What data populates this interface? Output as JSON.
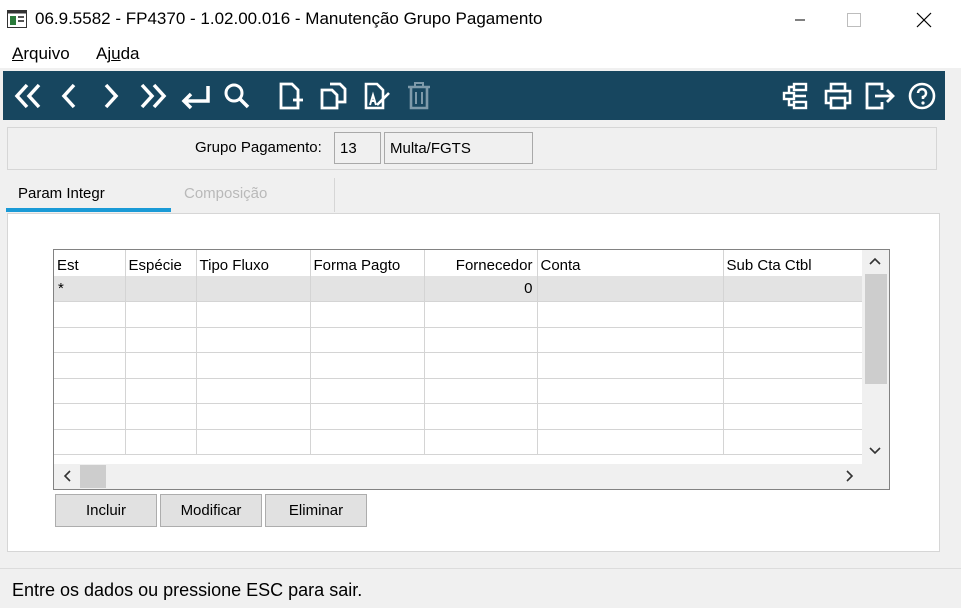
{
  "window": {
    "title": "06.9.5582 - FP4370 - 1.02.00.016 - Manutenção Grupo Pagamento"
  },
  "menu": {
    "items": [
      {
        "accel": "A",
        "rest": "rquivo"
      },
      {
        "pre": "Aj",
        "accel": "u",
        "rest": "da"
      }
    ]
  },
  "toolbar": {
    "icons": [
      "first-record-icon",
      "previous-record-icon",
      "next-record-icon",
      "last-record-icon",
      "enter-icon",
      "search-icon",
      "new-document-icon",
      "copy-icon",
      "edit-icon",
      "delete-icon",
      "structure-icon",
      "print-icon",
      "exit-icon",
      "help-icon"
    ],
    "bg_color": "#17465f"
  },
  "header": {
    "grupo_label": "Grupo Pagamento:",
    "grupo_code": "13",
    "grupo_desc": "Multa/FGTS"
  },
  "tabs": [
    {
      "label": "Param Integr",
      "active": true
    },
    {
      "label": "Composição",
      "active": false
    }
  ],
  "grid": {
    "columns": [
      "Est",
      "Espécie",
      "Tipo Fluxo",
      "Forma Pagto",
      "Fornecedor",
      "Conta",
      "Sub Cta Ctbl"
    ],
    "rows": [
      [
        "*",
        "",
        "",
        "",
        "0",
        "",
        ""
      ],
      [
        "",
        "",
        "",
        "",
        "",
        "",
        ""
      ],
      [
        "",
        "",
        "",
        "",
        "",
        "",
        ""
      ],
      [
        "",
        "",
        "",
        "",
        "",
        "",
        ""
      ],
      [
        "",
        "",
        "",
        "",
        "",
        "",
        ""
      ],
      [
        "",
        "",
        "",
        "",
        "",
        "",
        ""
      ],
      [
        "",
        "",
        "",
        "",
        "",
        "",
        ""
      ]
    ]
  },
  "buttons": {
    "incluir": "Incluir",
    "modificar": "Modificar",
    "eliminar": "Eliminar"
  },
  "status": {
    "text": "Entre os dados ou pressione ESC para sair."
  }
}
